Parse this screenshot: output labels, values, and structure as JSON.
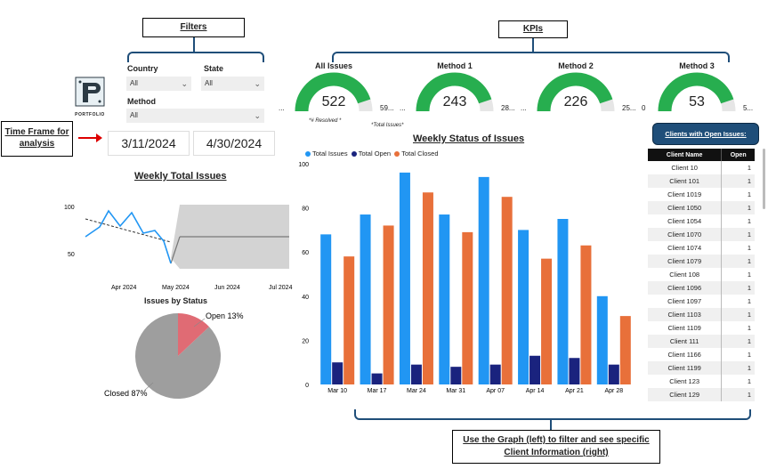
{
  "callouts": {
    "filters": "Filters",
    "kpis": "KPIs",
    "timeframe": "Time Frame for analysis",
    "bottom": "Use the Graph (left) to filter and see specific Client Information (right)"
  },
  "logo": {
    "text": "PORTFOLIO"
  },
  "filters": {
    "country_label": "Country",
    "country_value": "All",
    "state_label": "State",
    "state_value": "All",
    "method_label": "Method",
    "method_value": "All"
  },
  "dates": {
    "start": "3/11/2024",
    "end": "4/30/2024"
  },
  "kpis": [
    {
      "title": "All Issues",
      "value": "522",
      "left": "...",
      "right": "59...",
      "fraction": 0.9,
      "note_left": "*# Resolved *",
      "note_right": "*Total Issues*"
    },
    {
      "title": "Method 1",
      "value": "243",
      "left": "...",
      "right": "28...",
      "fraction": 0.9
    },
    {
      "title": "Method 2",
      "value": "226",
      "left": "...",
      "right": "25...",
      "fraction": 0.9
    },
    {
      "title": "Method 3",
      "value": "53",
      "left": "0",
      "right": "5...",
      "fraction": 0.9
    }
  ],
  "colors": {
    "accent_blue": "#1f4e79",
    "gauge_green": "#27ae4f",
    "total": "#2196f3",
    "open": "#1a237e",
    "closed": "#e8703a",
    "pie_open": "#e06b74",
    "pie_closed": "#9e9e9e"
  },
  "weekly_total": {
    "title": "Weekly Total Issues",
    "y_ticks": [
      "100",
      "50"
    ],
    "x_ticks": [
      "Apr 2024",
      "May 2024",
      "Jun 2024",
      "Jul 2024"
    ]
  },
  "pie": {
    "title": "Issues by Status",
    "open_label": "Open 13%",
    "closed_label": "Closed 87%",
    "open_pct": 13,
    "closed_pct": 87
  },
  "chart_data": {
    "type": "bar",
    "title": "Weekly Status of Issues",
    "categories": [
      "Mar 10",
      "Mar 17",
      "Mar 24",
      "Mar 31",
      "Apr 07",
      "Apr 14",
      "Apr 21",
      "Apr 28"
    ],
    "series": [
      {
        "name": "Total Issues",
        "values": [
          68,
          77,
          96,
          77,
          94,
          70,
          75,
          40
        ]
      },
      {
        "name": "Total Open",
        "values": [
          10,
          5,
          9,
          8,
          9,
          13,
          12,
          9
        ]
      },
      {
        "name": "Total Closed",
        "values": [
          58,
          72,
          87,
          69,
          85,
          57,
          63,
          31
        ]
      }
    ],
    "ylim": [
      0,
      100
    ],
    "y_ticks": [
      0,
      20,
      40,
      60,
      80,
      100
    ],
    "legend": "top-left"
  },
  "clients": {
    "title": "Clients with Open Issues:",
    "headers": [
      "Client Name",
      "Open"
    ],
    "rows": [
      [
        "Client 10",
        "1"
      ],
      [
        "Client 101",
        "1"
      ],
      [
        "Client 1019",
        "1"
      ],
      [
        "Client 1050",
        "1"
      ],
      [
        "Client 1054",
        "1"
      ],
      [
        "Client 1070",
        "1"
      ],
      [
        "Client 1074",
        "1"
      ],
      [
        "Client 1079",
        "1"
      ],
      [
        "Client 108",
        "1"
      ],
      [
        "Client 1096",
        "1"
      ],
      [
        "Client 1097",
        "1"
      ],
      [
        "Client 1103",
        "1"
      ],
      [
        "Client 1109",
        "1"
      ],
      [
        "Client 111",
        "1"
      ],
      [
        "Client 1166",
        "1"
      ],
      [
        "Client 1199",
        "1"
      ],
      [
        "Client 123",
        "1"
      ],
      [
        "Client 129",
        "1"
      ]
    ]
  }
}
